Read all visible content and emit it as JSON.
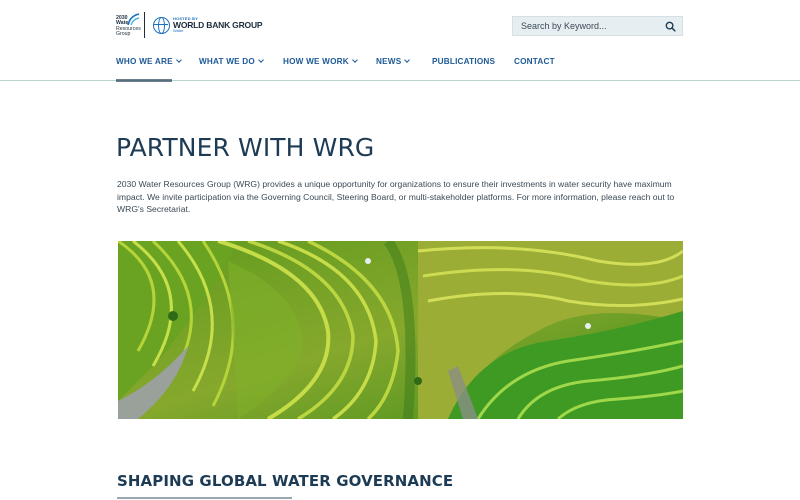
{
  "brand": {
    "wrg_lines": [
      "2030",
      "Water",
      "Resources",
      "Group"
    ],
    "wbg_hosted": "HOSTED BY",
    "wbg_name": "WORLD BANK GROUP",
    "wbg_sub": "Water"
  },
  "search": {
    "placeholder": "Search by Keyword..."
  },
  "nav": {
    "items": [
      {
        "label": "WHO WE ARE",
        "dropdown": true
      },
      {
        "label": "WHAT WE DO",
        "dropdown": true
      },
      {
        "label": "HOW WE WORK",
        "dropdown": true
      },
      {
        "label": "NEWS",
        "dropdown": true
      },
      {
        "label": "PUBLICATIONS",
        "dropdown": false
      },
      {
        "label": "CONTACT",
        "dropdown": false
      }
    ]
  },
  "main": {
    "title": "PARTNER WITH WRG",
    "intro": "2030 Water Resources Group (WRG) provides a unique opportunity for organizations to ensure their investments in water security have maximum impact. We invite participation via the Governing Council, Steering Board, or multi-stakeholder platforms. For more information, please reach out to WRG's Secretariat.",
    "hero_image": "aerial-rice-terraces",
    "section_heading": "SHAPING GLOBAL WATER GOVERNANCE"
  },
  "colors": {
    "brand_navy": "#1d3b55",
    "nav_blue": "#1d5a96",
    "search_bg": "#e7eef1",
    "header_border": "#b9d3cf"
  }
}
